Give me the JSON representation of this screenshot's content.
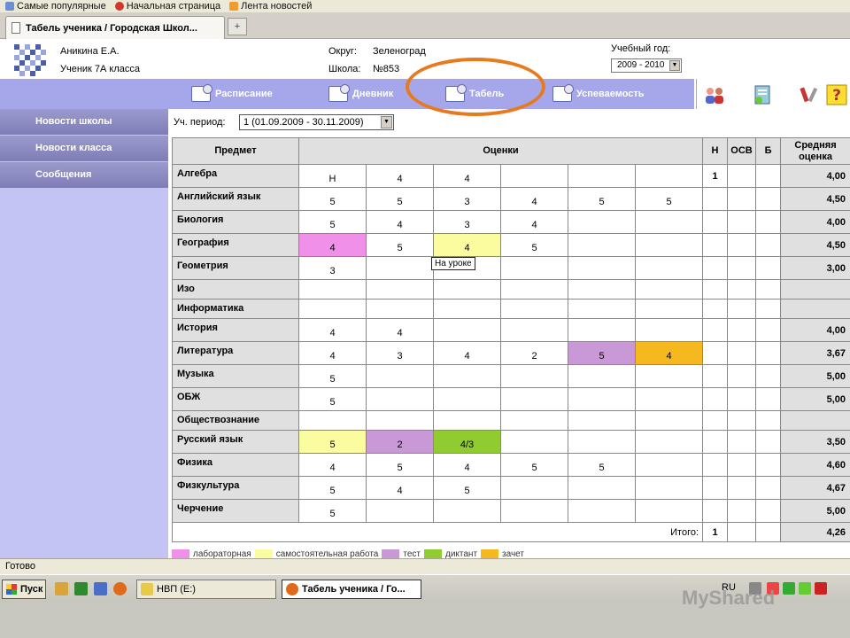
{
  "bookmarks": [
    "Самые популярные",
    "Начальная страница",
    "Лента новостей"
  ],
  "tab": {
    "title": "Табель ученика / Городская Школ...",
    "new_tab": "+"
  },
  "header": {
    "student_name": "Аникина Е.А.",
    "student_class": "Ученик 7А класса",
    "district_label": "Округ:",
    "district_value": "Зеленоград",
    "school_label": "Школа:",
    "school_value": "№853",
    "year_label": "Учебный год:",
    "year_value": "2009 - 2010"
  },
  "nav": {
    "schedule": "Расписание",
    "diary": "Дневник",
    "tabel": "Табель",
    "progress": "Успеваемость"
  },
  "sidebar": [
    "Новости школы",
    "Новости класса",
    "Сообщения"
  ],
  "period": {
    "label": "Уч. период:",
    "value": "1 (01.09.2009 - 30.11.2009)"
  },
  "table": {
    "headers": {
      "subject": "Предмет",
      "grades": "Оценки",
      "n": "Н",
      "osv": "ОСВ",
      "b": "Б",
      "avg": "Средняя оценка"
    },
    "rows": [
      {
        "subject": "Алгебра",
        "grades": [
          "Н",
          "4",
          "4",
          "",
          "",
          ""
        ],
        "n": "1",
        "avg": "4,00"
      },
      {
        "subject": "Английский язык",
        "grades": [
          "5",
          "5",
          "3",
          "4",
          "5",
          "5"
        ],
        "n": "",
        "avg": "4,50"
      },
      {
        "subject": "Биология",
        "grades": [
          "5",
          "4",
          "3",
          "4",
          "",
          ""
        ],
        "n": "",
        "avg": "4,00"
      },
      {
        "subject": "География",
        "grades": [
          "4",
          "5",
          "4",
          "5",
          "",
          ""
        ],
        "n": "",
        "avg": "4,50"
      },
      {
        "subject": "Геометрия",
        "grades": [
          "3",
          "",
          "",
          "",
          "",
          ""
        ],
        "n": "",
        "avg": "3,00"
      },
      {
        "subject": "Изо",
        "grades": [
          "",
          "",
          "",
          "",
          "",
          ""
        ],
        "n": "",
        "avg": ""
      },
      {
        "subject": "Информатика",
        "grades": [
          "",
          "",
          "",
          "",
          "",
          ""
        ],
        "n": "",
        "avg": ""
      },
      {
        "subject": "История",
        "grades": [
          "4",
          "4",
          "",
          "",
          "",
          ""
        ],
        "n": "",
        "avg": "4,00"
      },
      {
        "subject": "Литература",
        "grades": [
          "4",
          "3",
          "4",
          "2",
          "5",
          "4"
        ],
        "n": "",
        "avg": "3,67"
      },
      {
        "subject": "Музыка",
        "grades": [
          "5",
          "",
          "",
          "",
          "",
          ""
        ],
        "n": "",
        "avg": "5,00"
      },
      {
        "subject": "ОБЖ",
        "grades": [
          "5",
          "",
          "",
          "",
          "",
          ""
        ],
        "n": "",
        "avg": "5,00"
      },
      {
        "subject": "Обществознание",
        "grades": [
          "",
          "",
          "",
          "",
          "",
          ""
        ],
        "n": "",
        "avg": ""
      },
      {
        "subject": "Русский язык",
        "grades": [
          "5",
          "2",
          "4/3",
          "",
          "",
          ""
        ],
        "n": "",
        "avg": "3,50"
      },
      {
        "subject": "Физика",
        "grades": [
          "4",
          "5",
          "4",
          "5",
          "5",
          ""
        ],
        "n": "",
        "avg": "4,60"
      },
      {
        "subject": "Физкультура",
        "grades": [
          "5",
          "4",
          "5",
          "",
          "",
          ""
        ],
        "n": "",
        "avg": "4,67"
      },
      {
        "subject": "Черчение",
        "grades": [
          "5",
          "",
          "",
          "",
          "",
          ""
        ],
        "n": "",
        "avg": "5,00"
      }
    ],
    "total": {
      "label": "Итого:",
      "n": "1",
      "avg": "4,26"
    }
  },
  "tooltip": "На уроке",
  "legend": [
    "лабораторная",
    "самостоятельная работа",
    "тест",
    "диктант",
    "зачет"
  ],
  "colors": {
    "lab": "#f090e8",
    "sam": "#fbfba0",
    "test": "#c998d6",
    "dict": "#90cc30",
    "zach": "#f5b81f",
    "highlight": "#e87a1e",
    "nav_bg": "#a6a6ea"
  },
  "statusbar": "Готово",
  "taskbar": {
    "start": "Пуск",
    "task1": "НВП (E:)",
    "task2": "Табель ученика / Го...",
    "lang": "RU",
    "watermark": "MyShared"
  }
}
